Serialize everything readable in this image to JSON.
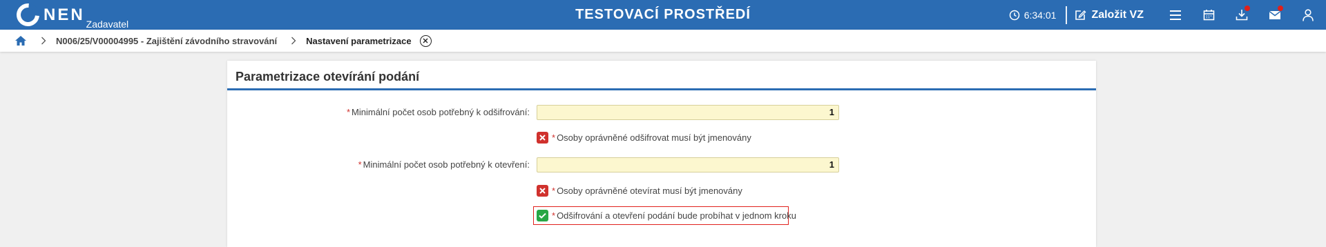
{
  "header": {
    "logo_text": "NEN",
    "logo_sub": "Zadavatel",
    "env_title": "TESTOVACÍ PROSTŘEDÍ",
    "clock": "6:34:01",
    "create_vz_label": "Založit VZ",
    "icons": [
      "clock-icon",
      "edit-icon",
      "menu-icon",
      "calendar-icon",
      "download-icon",
      "mail-icon",
      "user-icon"
    ],
    "notification_color": "#e0201b",
    "brand_color": "#2b6cb3"
  },
  "breadcrumb": {
    "items": [
      {
        "label": "N006/25/V00004995 - Zajištění závodního stravování"
      },
      {
        "label": "Nastavení parametrizace"
      }
    ]
  },
  "panel": {
    "title": "Parametrizace otevírání podání",
    "fields": [
      {
        "required_mark": "*",
        "label": "Minimální počet osob potřebný k odšifrování:",
        "value": "1"
      },
      {
        "required_mark": "*",
        "label": "Minimální počet osob potřebný k otevření:",
        "value": "1"
      }
    ],
    "checks": [
      {
        "required_mark": "*",
        "label": "Osoby oprávněné odšifrovat musí být jmenovány",
        "checked": false
      },
      {
        "required_mark": "*",
        "label": "Osoby oprávněné otevírat musí být jmenovány",
        "checked": false
      },
      {
        "required_mark": "*",
        "label": "Odšifrování a otevření podání bude probíhat v jednom kroku",
        "checked": true
      }
    ]
  }
}
